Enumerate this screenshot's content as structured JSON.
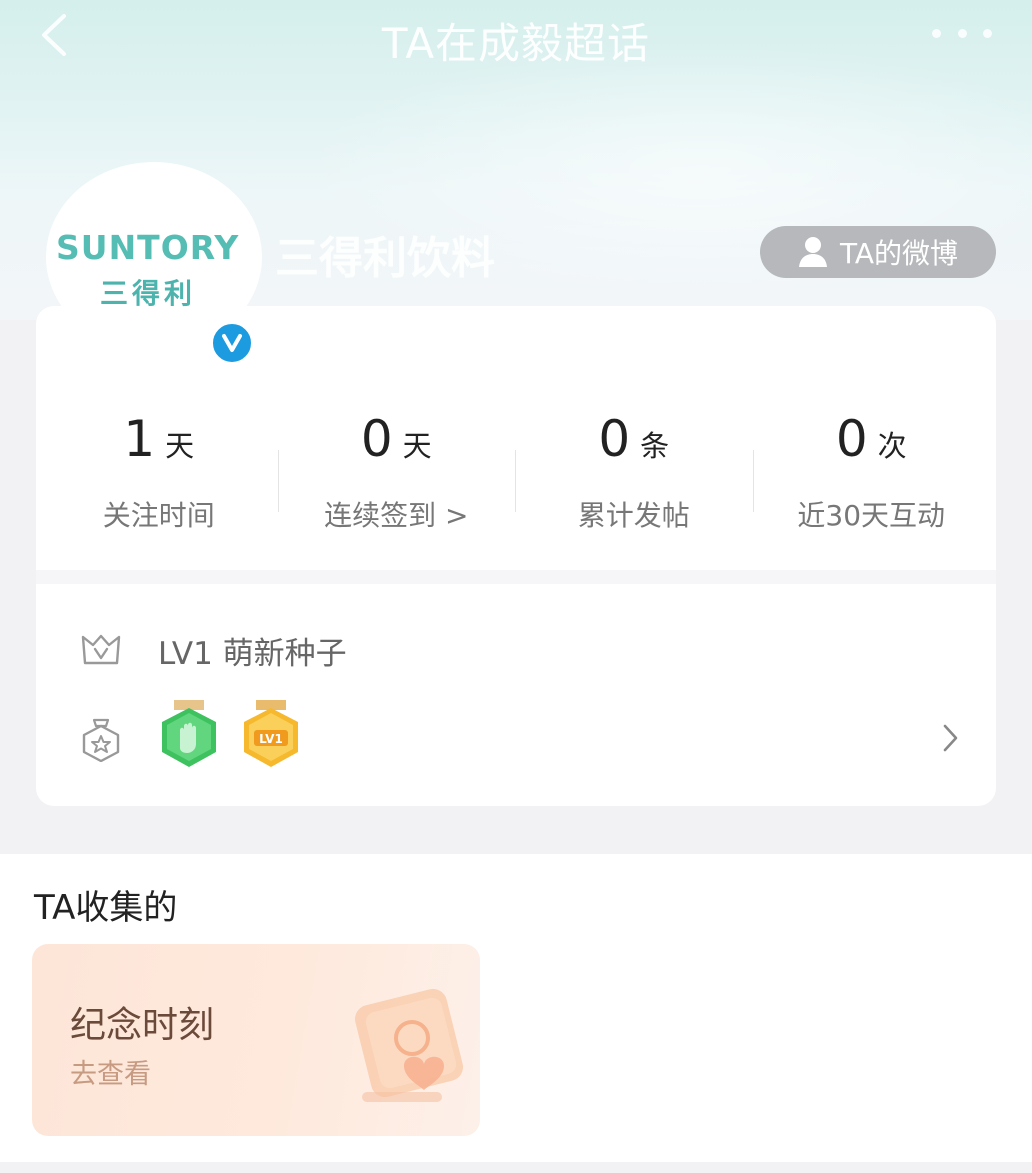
{
  "header": {
    "title": "TA在成毅超话"
  },
  "profile": {
    "logo_en": "SUNTORY",
    "logo_cn": "三得利",
    "username": "三得利饮料",
    "weibo_button": "TA的微博"
  },
  "stats": [
    {
      "value": "1",
      "unit": "天",
      "label": "关注时间"
    },
    {
      "value": "0",
      "unit": "天",
      "label": "连续签到 >"
    },
    {
      "value": "0",
      "unit": "条",
      "label": "累计发帖"
    },
    {
      "value": "0",
      "unit": "次",
      "label": "近30天互动"
    }
  ],
  "level": {
    "text": "LV1 萌新种子",
    "medal_lv_text": "LV1"
  },
  "collection": {
    "title": "TA收集的",
    "card_title": "纪念时刻",
    "card_subtitle": "去查看"
  },
  "colors": {
    "brand_teal": "#56bdb4",
    "verified_blue": "#1c9be0",
    "weibo_button_bg": "#b6b8bb",
    "medal_green": "#3ec25f",
    "medal_gold": "#f6b82c"
  }
}
